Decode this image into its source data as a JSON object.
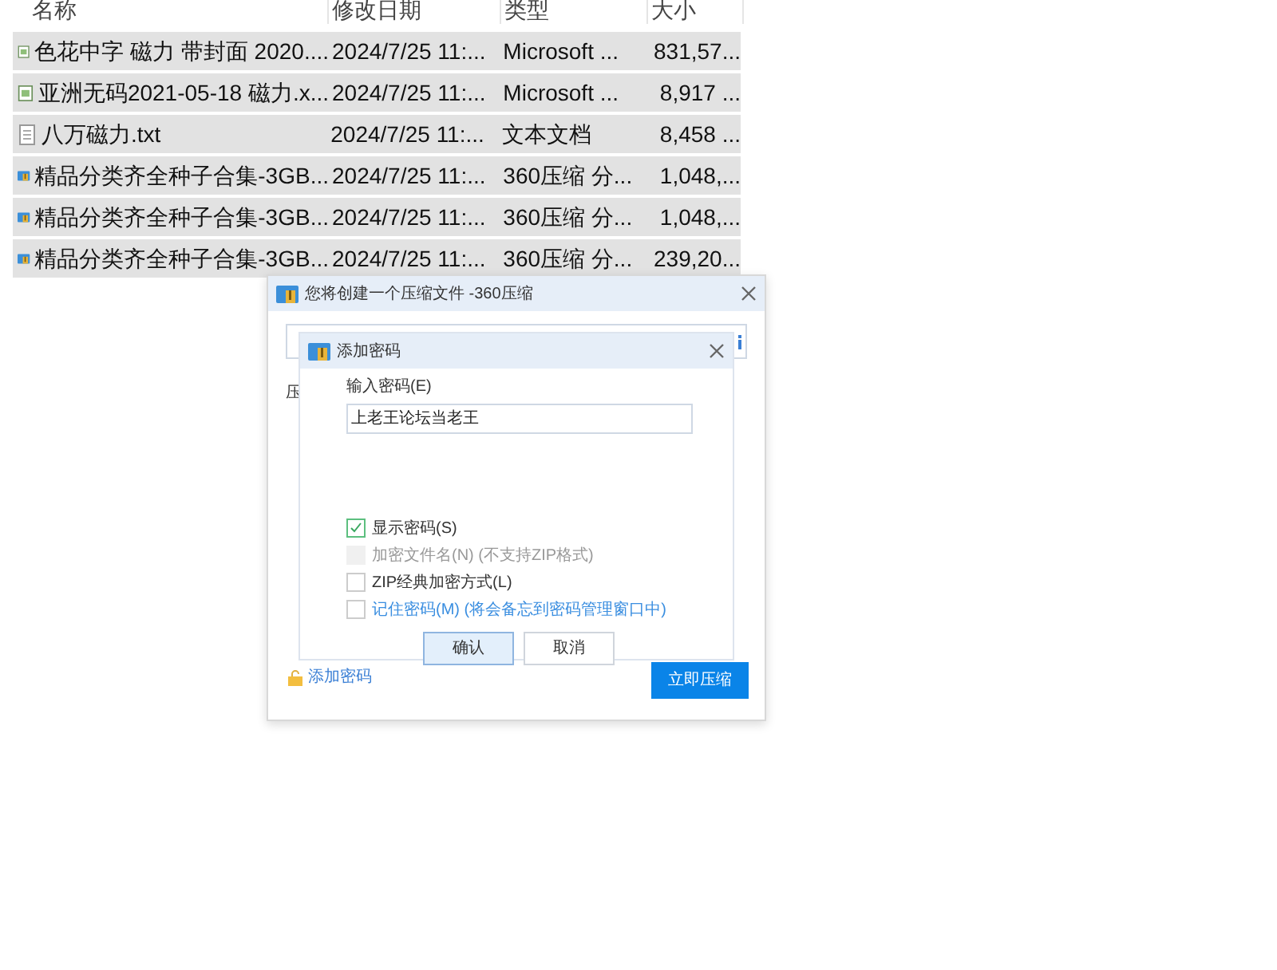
{
  "file_list": {
    "columns": [
      "名称",
      "修改日期",
      "类型",
      "大小"
    ],
    "rows": [
      {
        "kind": "sheet",
        "selected": true,
        "name": "色花中字 磁力 带封面 2020....",
        "date": "2024/7/25 11:...",
        "type": "Microsoft ...",
        "size": "831,57..."
      },
      {
        "kind": "sheet",
        "selected": true,
        "name": "亚洲无码2021-05-18 磁力.x...",
        "date": "2024/7/25 11:...",
        "type": "Microsoft ...",
        "size": "8,917 ..."
      },
      {
        "kind": "text",
        "selected": true,
        "name": "八万磁力.txt",
        "date": "2024/7/25 11:...",
        "type": "文本文档",
        "size": "8,458 ..."
      },
      {
        "kind": "archive",
        "selected": true,
        "name": "精品分类齐全种子合集-3GB...",
        "date": "2024/7/25 11:...",
        "type": "360压缩 分...",
        "size": "1,048,..."
      },
      {
        "kind": "archive",
        "selected": true,
        "name": "精品分类齐全种子合集-3GB...",
        "date": "2024/7/25 11:...",
        "type": "360压缩 分...",
        "size": "1,048,..."
      },
      {
        "kind": "archive",
        "selected": true,
        "name": "精品分类齐全种子合集-3GB...",
        "date": "2024/7/25 11:...",
        "type": "360压缩 分...",
        "size": "239,20..."
      }
    ]
  },
  "compress_dialog": {
    "title": "您将创建一个压缩文件 -360压缩",
    "partial_label": "压",
    "add_password_link": "添加密码",
    "compress_button": "立即压缩"
  },
  "password_dialog": {
    "title": "添加密码",
    "password_label": "输入密码(E)",
    "password_value": "上老王论坛当老王",
    "options": [
      {
        "label": "显示密码(S)",
        "checked": true,
        "disabled": false,
        "link": false
      },
      {
        "label": "加密文件名(N) (不支持ZIP格式)",
        "checked": false,
        "disabled": true,
        "link": false
      },
      {
        "label": "ZIP经典加密方式(L)",
        "checked": false,
        "disabled": false,
        "link": false
      },
      {
        "label": "记住密码(M) (将会备忘到密码管理窗口中)",
        "checked": false,
        "disabled": false,
        "link": true
      }
    ],
    "buttons": [
      {
        "label": "确认",
        "selected": true
      },
      {
        "label": "取消",
        "selected": false
      }
    ]
  }
}
